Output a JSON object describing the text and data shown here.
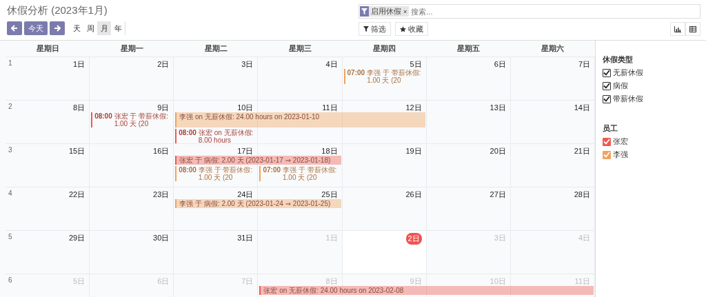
{
  "title": "休假分析 (2023年1月)",
  "nav": {
    "today": "今天"
  },
  "views": [
    {
      "label": "天",
      "selected": false
    },
    {
      "label": "周",
      "selected": false
    },
    {
      "label": "月",
      "selected": true
    },
    {
      "label": "年",
      "selected": false
    }
  ],
  "search": {
    "facets": [
      {
        "label": "启用休假",
        "remove": "×"
      }
    ],
    "placeholder": "搜索..."
  },
  "search_buttons": [
    {
      "kind": "filter",
      "label": "筛选"
    },
    {
      "kind": "favorite",
      "label": "收藏"
    }
  ],
  "view_switcher": [
    {
      "kind": "graph",
      "selected": false
    },
    {
      "kind": "table",
      "selected": false
    }
  ],
  "weekdays": [
    "星期日",
    "星期一",
    "星期二",
    "星期三",
    "星期四",
    "星期五",
    "星期六"
  ],
  "weeks": [
    {
      "number": "1",
      "days": [
        {
          "label": "1日",
          "other_month": false,
          "today": false
        },
        {
          "label": "2日",
          "other_month": false,
          "today": false
        },
        {
          "label": "3日",
          "other_month": false,
          "today": false
        },
        {
          "label": "4日",
          "other_month": false,
          "today": false
        },
        {
          "label": "5日",
          "other_month": false,
          "today": false,
          "events": [
            {
              "kind": "timed",
              "time": "07:00",
              "text": "李强 于 带薪休假: 1.00 天 (20",
              "color": "#f0a35e"
            }
          ]
        },
        {
          "label": "6日",
          "other_month": false,
          "today": false
        },
        {
          "label": "7日",
          "other_month": false,
          "today": false
        }
      ]
    },
    {
      "number": "2",
      "days": [
        {
          "label": "8日",
          "other_month": false,
          "today": false
        },
        {
          "label": "9日",
          "other_month": false,
          "today": false,
          "events": [
            {
              "kind": "timed",
              "time": "08:00",
              "text": "张宏 于 带薪休假: 1.00 天 (20",
              "color": "#ee5a52"
            }
          ]
        },
        {
          "label": "10日",
          "other_month": false,
          "today": false,
          "events": [
            {
              "kind": "bar",
              "text": "李强 on 无薪休假: 24.00 hours on 2023-01-10",
              "color": "#f0a35e"
            },
            {
              "kind": "timed",
              "time": "08:00",
              "text": "张宏 on 无薪休假: 8.00 hours",
              "color": "#ee5a52"
            }
          ]
        },
        {
          "label": "11日",
          "other_month": false,
          "today": false,
          "bar_continues": true
        },
        {
          "label": "12日",
          "other_month": false,
          "today": false,
          "bar_continues": true
        },
        {
          "label": "13日",
          "other_month": false,
          "today": false
        },
        {
          "label": "14日",
          "other_month": false,
          "today": false
        }
      ]
    },
    {
      "number": "3",
      "days": [
        {
          "label": "15日",
          "other_month": false,
          "today": false
        },
        {
          "label": "16日",
          "other_month": false,
          "today": false
        },
        {
          "label": "17日",
          "other_month": false,
          "today": false,
          "events": [
            {
              "kind": "bar",
              "text": "张宏 于 病假: 2.00 天 (2023-01-17 ⇒ 2023-01-18)",
              "color": "#ee5a52"
            },
            {
              "kind": "timed",
              "time": "08:00",
              "text": "李强 于 带薪休假: 1.00 天 (20",
              "color": "#f0a35e"
            }
          ]
        },
        {
          "label": "18日",
          "other_month": false,
          "today": false,
          "bar_continues": true,
          "events": [
            {
              "kind": "timed",
              "time": "07:00",
              "text": "李强 于 带薪休假: 1.00 天 (20",
              "color": "#f0a35e"
            }
          ]
        },
        {
          "label": "19日",
          "other_month": false,
          "today": false
        },
        {
          "label": "20日",
          "other_month": false,
          "today": false
        },
        {
          "label": "21日",
          "other_month": false,
          "today": false
        }
      ]
    },
    {
      "number": "4",
      "days": [
        {
          "label": "22日",
          "other_month": false,
          "today": false
        },
        {
          "label": "23日",
          "other_month": false,
          "today": false
        },
        {
          "label": "24日",
          "other_month": false,
          "today": false,
          "events": [
            {
              "kind": "bar",
              "text": "李强 于 病假: 2.00 天 (2023-01-24 ⇒ 2023-01-25)",
              "color": "#f0a35e"
            }
          ]
        },
        {
          "label": "25日",
          "other_month": false,
          "today": false,
          "bar_continues": true
        },
        {
          "label": "26日",
          "other_month": false,
          "today": false
        },
        {
          "label": "27日",
          "other_month": false,
          "today": false
        },
        {
          "label": "28日",
          "other_month": false,
          "today": false
        }
      ]
    },
    {
      "number": "5",
      "days": [
        {
          "label": "29日",
          "other_month": false,
          "today": false
        },
        {
          "label": "30日",
          "other_month": false,
          "today": false
        },
        {
          "label": "31日",
          "other_month": false,
          "today": false
        },
        {
          "label": "1日",
          "other_month": true,
          "today": false
        },
        {
          "label": "2日",
          "other_month": true,
          "today": true
        },
        {
          "label": "3日",
          "other_month": true,
          "today": false
        },
        {
          "label": "4日",
          "other_month": true,
          "today": false
        }
      ]
    },
    {
      "number": "6",
      "days": [
        {
          "label": "5日",
          "other_month": true,
          "today": false
        },
        {
          "label": "6日",
          "other_month": true,
          "today": false
        },
        {
          "label": "7日",
          "other_month": true,
          "today": false
        },
        {
          "label": "8日",
          "other_month": true,
          "today": false,
          "events": [
            {
              "kind": "bar",
              "text": "张宏 on 无薪休假: 24.00 hours on 2023-02-08",
              "color": "#ee5a52"
            }
          ]
        },
        {
          "label": "9日",
          "other_month": true,
          "today": false,
          "bar_continues": true
        },
        {
          "label": "10日",
          "other_month": true,
          "today": false,
          "bar_continues": true
        },
        {
          "label": "11日",
          "other_month": true,
          "today": false,
          "bar_continues": true
        }
      ]
    }
  ],
  "filters": [
    {
      "title": "休假类型",
      "items": [
        {
          "label": "无薪休假",
          "checked": true
        },
        {
          "label": "病假",
          "checked": true
        },
        {
          "label": "带薪休假",
          "checked": true
        }
      ]
    },
    {
      "title": "员工",
      "items": [
        {
          "label": "张宏",
          "checked": true,
          "color": "#ee5a52"
        },
        {
          "label": "李强",
          "checked": true,
          "color": "#f0a35e"
        }
      ]
    }
  ]
}
